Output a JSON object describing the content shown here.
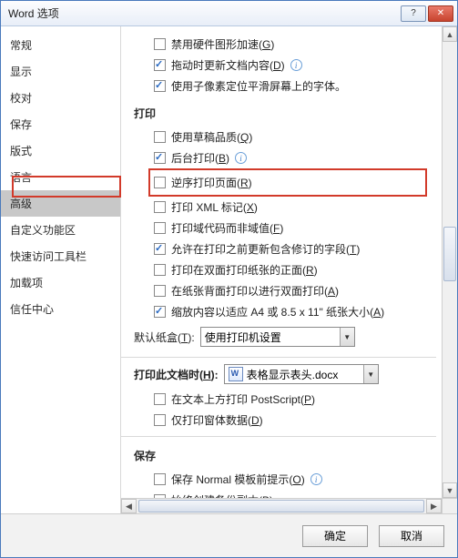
{
  "title": "Word 选项",
  "sidebar": {
    "items": [
      {
        "label": "常规"
      },
      {
        "label": "显示"
      },
      {
        "label": "校对"
      },
      {
        "label": "保存"
      },
      {
        "label": "版式"
      },
      {
        "label": "语言"
      },
      {
        "label": "高级"
      },
      {
        "label": "自定义功能区"
      },
      {
        "label": "快速访问工具栏"
      },
      {
        "label": "加载项"
      },
      {
        "label": "信任中心"
      }
    ],
    "active_index": 6
  },
  "top_options": [
    {
      "checked": false,
      "label": "禁用硬件图形加速(",
      "hot": "G",
      "tail": ")"
    },
    {
      "checked": true,
      "label": "拖动时更新文档内容(",
      "hot": "D",
      "tail": ")",
      "info": true
    },
    {
      "checked": true,
      "label": "使用子像素定位平滑屏幕上的字体。"
    }
  ],
  "sections": {
    "print": {
      "title": "打印",
      "options": [
        {
          "checked": false,
          "label": "使用草稿品质(",
          "hot": "Q",
          "tail": ")"
        },
        {
          "checked": true,
          "label": "后台打印(",
          "hot": "B",
          "tail": ")",
          "info": true
        },
        {
          "checked": false,
          "label": "逆序打印页面(",
          "hot": "R",
          "tail": ")",
          "highlighted": true
        },
        {
          "checked": false,
          "label": "打印 XML 标记(",
          "hot": "X",
          "tail": ")"
        },
        {
          "checked": false,
          "label": "打印域代码而非域值(",
          "hot": "F",
          "tail": ")"
        },
        {
          "checked": true,
          "label": "允许在打印之前更新包含修订的字段(",
          "hot": "T",
          "tail": ")"
        },
        {
          "checked": false,
          "label": "打印在双面打印纸张的正面(",
          "hot": "R",
          "tail": ")"
        },
        {
          "checked": false,
          "label": "在纸张背面打印以进行双面打印(",
          "hot": "A",
          "tail": ")"
        },
        {
          "checked": true,
          "label": "缩放内容以适应 A4 或 8.5 x 11\" 纸张大小(",
          "hot": "A",
          "tail": ")"
        }
      ],
      "tray_label": "默认纸盒(",
      "tray_hot": "T",
      "tray_tail": "):",
      "tray_value": "使用打印机设置"
    },
    "print_doc": {
      "title_label": "打印此文档时(",
      "title_hot": "H",
      "title_tail": "):",
      "doc_value": "表格显示表头.docx",
      "options": [
        {
          "checked": false,
          "label": "在文本上方打印 PostScript(",
          "hot": "P",
          "tail": ")"
        },
        {
          "checked": false,
          "label": "仅打印窗体数据(",
          "hot": "D",
          "tail": ")"
        }
      ]
    },
    "save": {
      "title": "保存",
      "options": [
        {
          "checked": false,
          "label": "保存 Normal 模板前提示(",
          "hot": "O",
          "tail": ")",
          "info": true
        },
        {
          "checked": false,
          "label": "始终创建备份副本(",
          "hot": "B",
          "tail": ")"
        }
      ]
    }
  },
  "footer": {
    "ok": "确定",
    "cancel": "取消"
  }
}
